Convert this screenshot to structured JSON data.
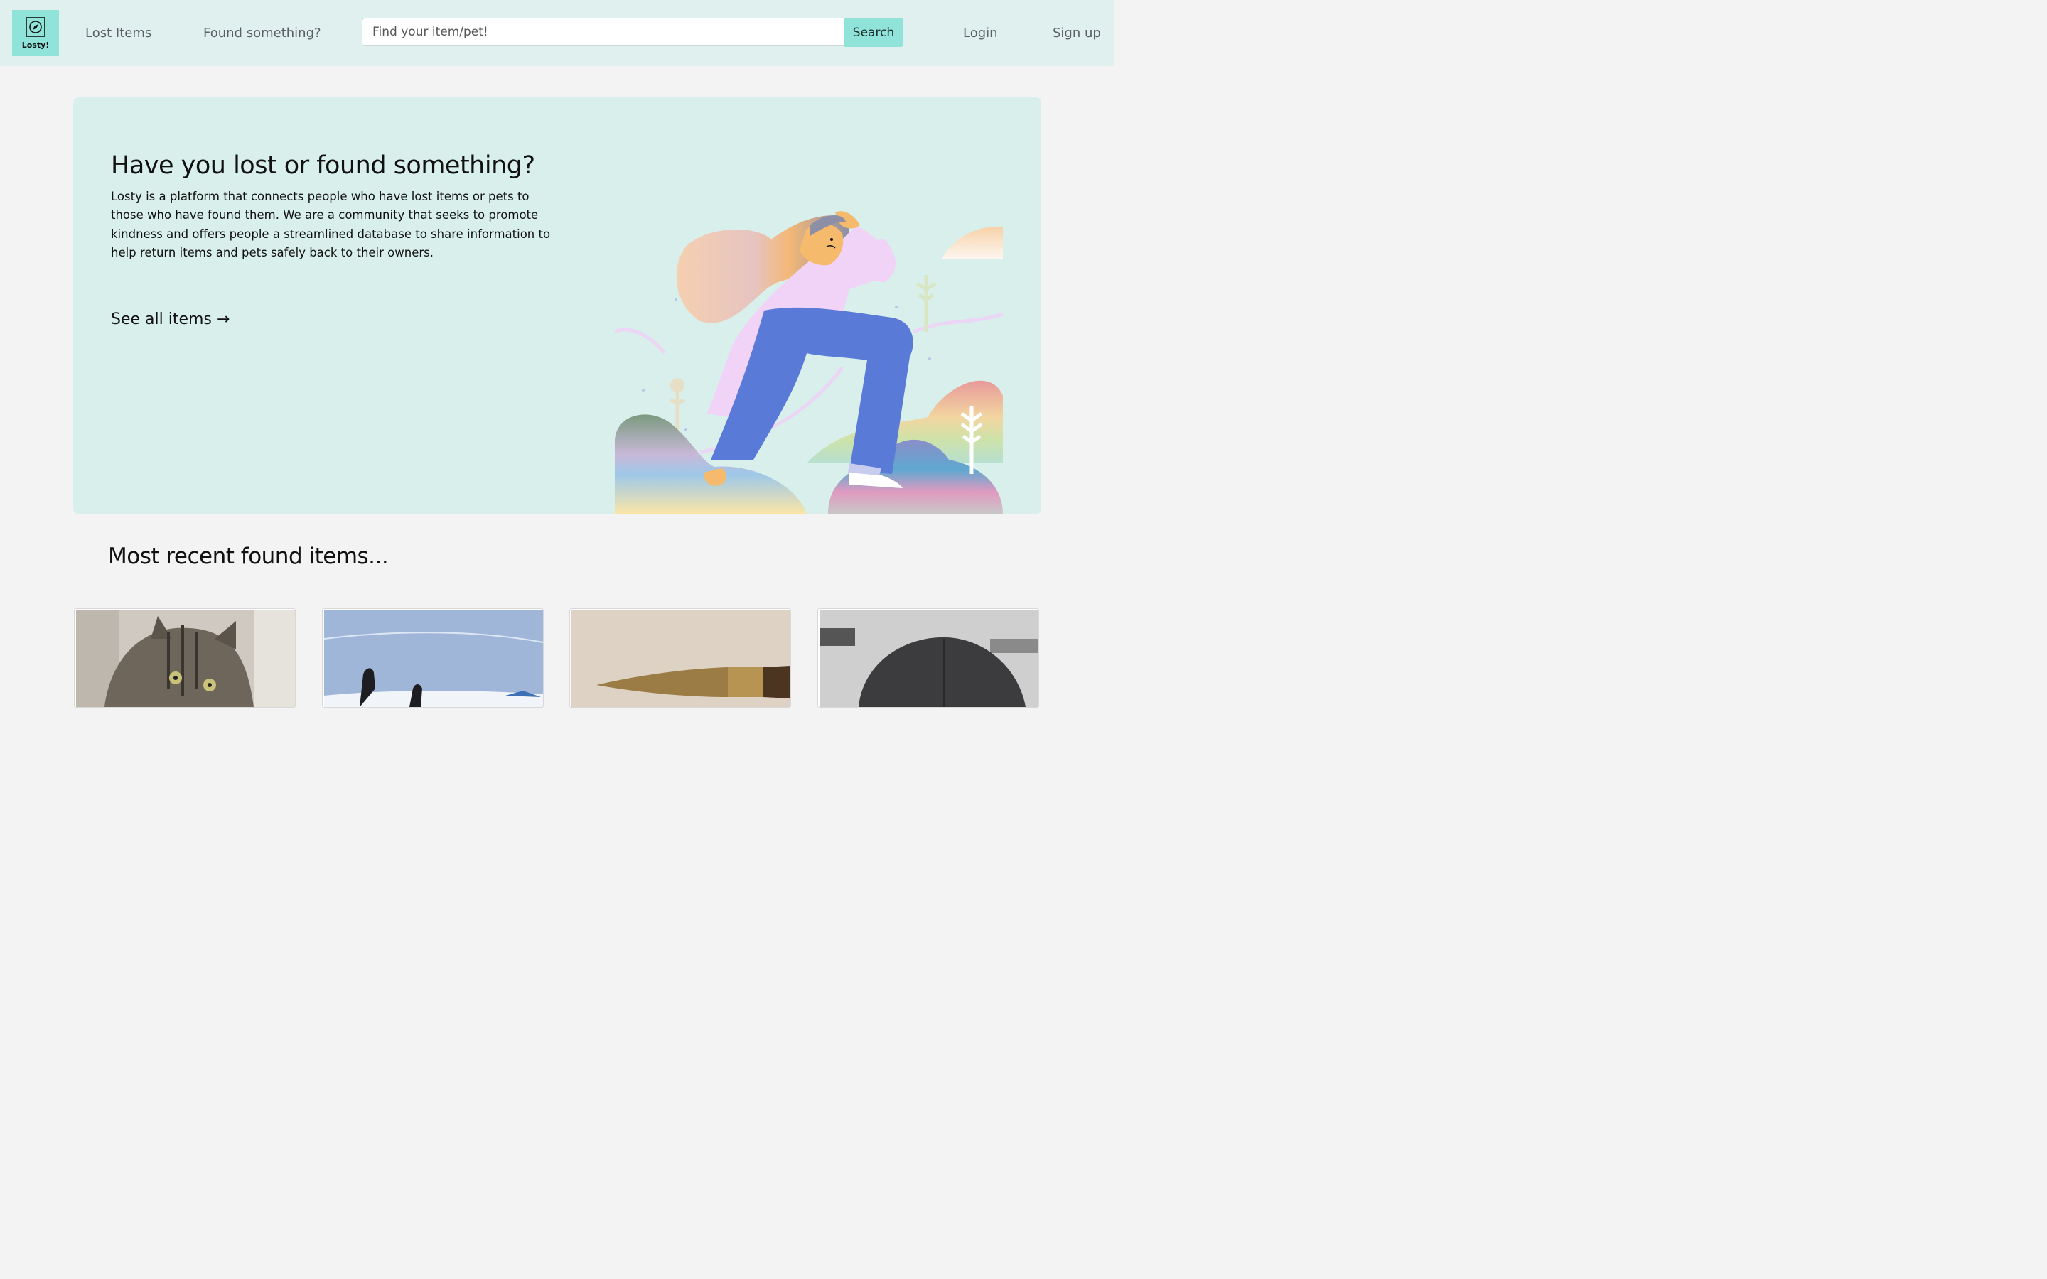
{
  "nav": {
    "logo_text": "Losty!",
    "lost_items": "Lost Items",
    "found_something": "Found something?",
    "search_placeholder": "Find your item/pet!",
    "search_button": "Search",
    "login": "Login",
    "signup": "Sign up"
  },
  "hero": {
    "title": "Have you lost or found something?",
    "description": "Losty is a platform that connects people who have lost items or pets to those who have found them. We are a community that seeks to promote kindness and offers people a streamlined database to share information to help return items and pets safely back to their owners.",
    "cta": "See all items →"
  },
  "recent": {
    "title": "Most recent found items...",
    "cards": [
      {
        "image": "tabby-cat-photo"
      },
      {
        "image": "ski-gloves-snow-photo"
      },
      {
        "image": "fountain-pen-photo"
      },
      {
        "image": "black-cap-photo"
      }
    ]
  },
  "colors": {
    "accent": "#8fe3d9",
    "nav_bg": "#e0f0ee",
    "hero_bg": "#d8efeb",
    "page_bg": "#f3f3f3"
  }
}
